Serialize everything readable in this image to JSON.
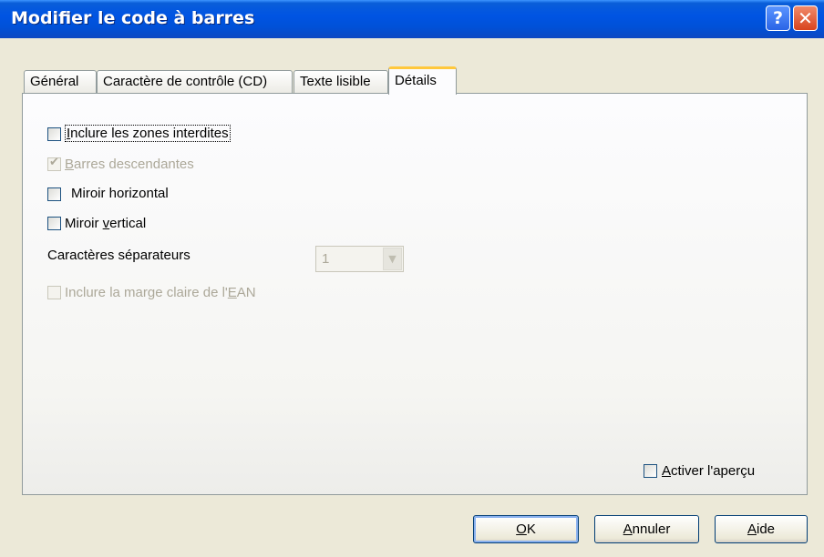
{
  "window": {
    "title": "Modifier le code à barres",
    "help_icon": "help-icon",
    "close_icon": "close-icon"
  },
  "tabs": [
    {
      "label": "Général",
      "active": false
    },
    {
      "label": "Caractère de contrôle (CD)",
      "active": false
    },
    {
      "label": "Texte lisible",
      "active": false
    },
    {
      "label": "Détails",
      "active": true
    }
  ],
  "details": {
    "include_quiet_zones": {
      "label_first": "I",
      "label_rest": "nclure les zones interdites",
      "checked": false,
      "enabled": true
    },
    "descending_bars": {
      "label_first": "B",
      "label_rest": "arres descendantes",
      "checked": true,
      "enabled": false
    },
    "mirror_horizontal": {
      "label": "Miroir horizontal",
      "checked": false,
      "enabled": true
    },
    "mirror_vertical": {
      "label_pre": "Miroir ",
      "label_first": "v",
      "label_rest": "ertical",
      "checked": false,
      "enabled": true
    },
    "separator_chars": {
      "label": "Caractères séparateurs",
      "value": "1",
      "enabled": false
    },
    "ean_light_margin": {
      "label_pre": "Inclure la marge claire de l'",
      "label_first": "E",
      "label_rest": "AN",
      "checked": false,
      "enabled": false
    }
  },
  "preview": {
    "label_first": "A",
    "label_rest": "ctiver l'aperçu",
    "checked": false
  },
  "buttons": {
    "ok_first": "O",
    "ok_rest": "K",
    "cancel_first": "A",
    "cancel_rest": "nnuler",
    "help_first": "A",
    "help_rest": "ide"
  }
}
